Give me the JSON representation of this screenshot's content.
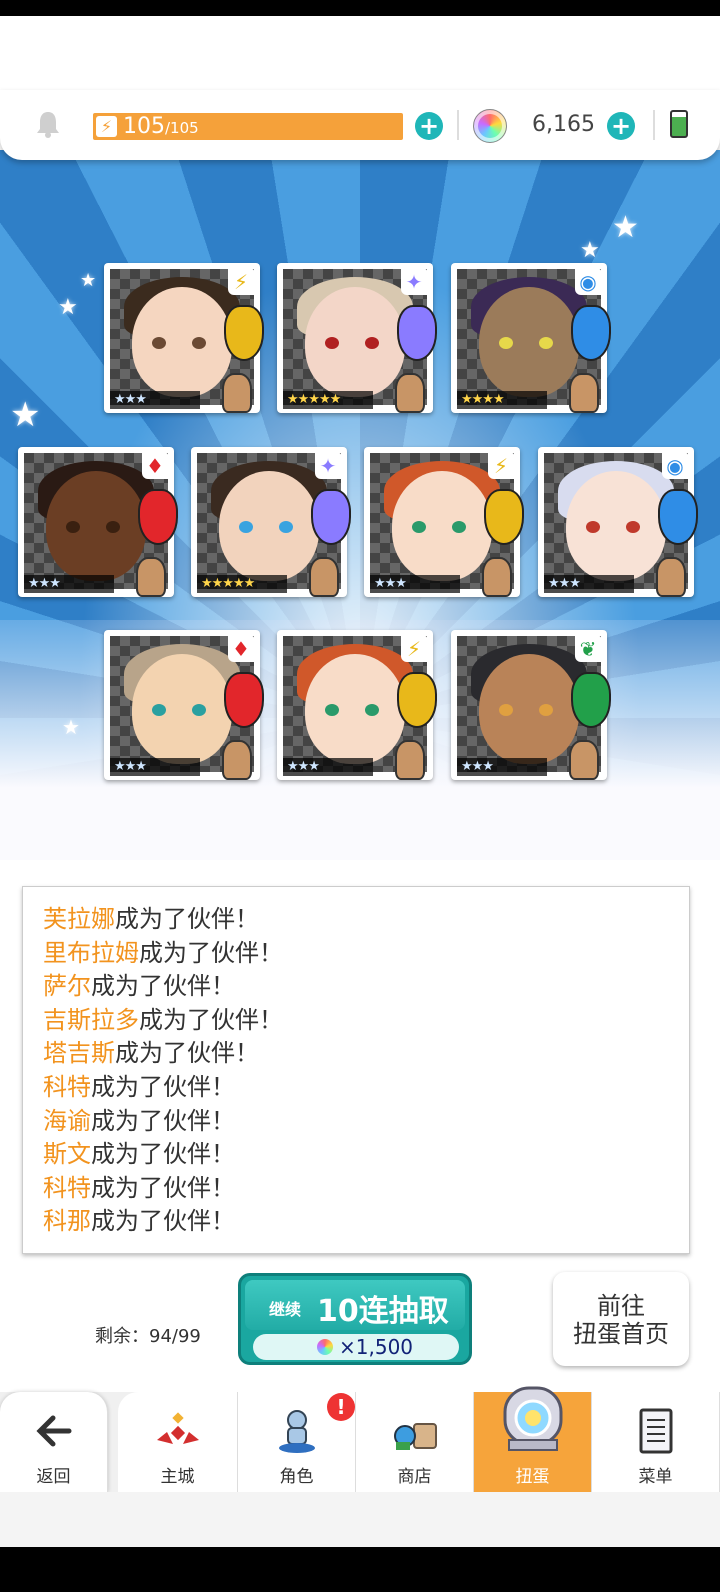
{
  "header": {
    "energy_current": "105",
    "energy_max": "/105",
    "gems": "6,165"
  },
  "cards": [
    {
      "stars": "★★★",
      "element": "⚡",
      "crystal": "#e8b81a",
      "hair": "#3b2b1e",
      "skin": "#f5d6c0",
      "eye": "#6b4a34",
      "gold": false
    },
    {
      "stars": "★★★★★",
      "element": "✦",
      "crystal": "#8a7bff",
      "hair": "#d8c8b0",
      "skin": "#f3d6c8",
      "eye": "#b02020",
      "gold": true
    },
    {
      "stars": "★★★★",
      "element": "◉",
      "crystal": "#2f8de6",
      "hair": "#3b2a55",
      "skin": "#9b7b5a",
      "eye": "#e6d84a",
      "gold": true
    },
    {
      "stars": "★★★",
      "element": "♦",
      "crystal": "#e2262b",
      "hair": "#2a1a14",
      "skin": "#6b3e24",
      "eye": "#3a2010",
      "gold": false
    },
    {
      "stars": "★★★★★",
      "element": "✦",
      "crystal": "#8a7bff",
      "hair": "#3a2a20",
      "skin": "#f2d3bd",
      "eye": "#3aa3e0",
      "gold": true
    },
    {
      "stars": "★★★",
      "element": "⚡",
      "crystal": "#e8b81a",
      "hair": "#d0582a",
      "skin": "#f8dcc8",
      "eye": "#2a9a6a",
      "gold": false
    },
    {
      "stars": "★★★",
      "element": "◉",
      "crystal": "#2f8de6",
      "hair": "#d8dcef",
      "skin": "#f8e2d6",
      "eye": "#c0392b",
      "gold": false
    },
    {
      "stars": "★★★",
      "element": "♦",
      "crystal": "#e2262b",
      "hair": "#b8a48a",
      "skin": "#f3d3b0",
      "eye": "#2aa0a0",
      "gold": false
    },
    {
      "stars": "★★★",
      "element": "⚡",
      "crystal": "#e8b81a",
      "hair": "#d0582a",
      "skin": "#f8dcc8",
      "eye": "#2a9a6a",
      "gold": false
    },
    {
      "stars": "★★★",
      "element": "❦",
      "crystal": "#22a04a",
      "hair": "#2a2a2e",
      "skin": "#b98358",
      "eye": "#e0a040",
      "gold": false
    }
  ],
  "log": [
    {
      "name": "芙拉娜",
      "text": "成为了伙伴！"
    },
    {
      "name": "里布拉姆",
      "text": "成为了伙伴！"
    },
    {
      "name": "萨尔",
      "text": "成为了伙伴！"
    },
    {
      "name": "吉斯拉多",
      "text": "成为了伙伴！"
    },
    {
      "name": "塔吉斯",
      "text": "成为了伙伴！"
    },
    {
      "name": "科特",
      "text": "成为了伙伴！"
    },
    {
      "name": "海谕",
      "text": "成为了伙伴！"
    },
    {
      "name": "斯文",
      "text": "成为了伙伴！"
    },
    {
      "name": "科特",
      "text": "成为了伙伴！"
    },
    {
      "name": "科那",
      "text": "成为了伙伴！"
    }
  ],
  "controls": {
    "remaining": "剩余：94/99",
    "continue": "继续",
    "pull_label": "10连抽取",
    "pull_cost": "×1,500",
    "goto_line1": "前往",
    "goto_line2": "扭蛋首页"
  },
  "nav": {
    "back": "返回",
    "home": "主城",
    "characters": "角色",
    "shop": "商店",
    "gacha": "扭蛋",
    "menu": "菜单",
    "badge": "!"
  },
  "colors": {
    "accent_orange": "#f6a43b",
    "teal": "#1fb6b8",
    "name_orange": "#f2931e"
  }
}
